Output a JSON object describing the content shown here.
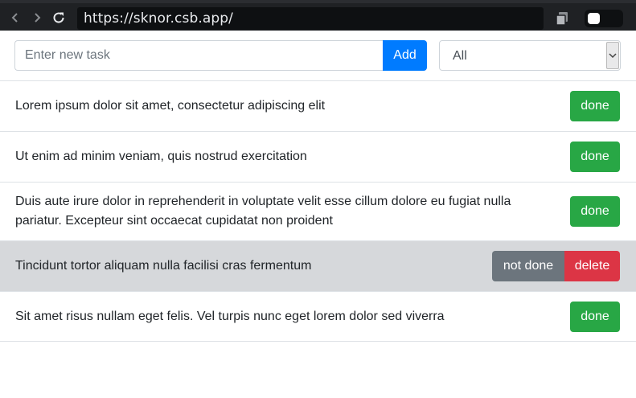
{
  "browser": {
    "url": "https://sknor.csb.app/"
  },
  "form": {
    "input_placeholder": "Enter new task",
    "input_value": "",
    "add_label": "Add",
    "filter_selected": "All"
  },
  "tasks": [
    {
      "text": "Lorem ipsum dolor sit amet, consectetur adipiscing elit",
      "completed": false,
      "done_label": "done"
    },
    {
      "text": "Ut enim ad minim veniam, quis nostrud exercitation",
      "completed": false,
      "done_label": "done"
    },
    {
      "text": "Duis aute irure dolor in reprehenderit in voluptate velit esse cillum dolore eu fugiat nulla pariatur. Excepteur sint occaecat cupidatat non proident",
      "completed": false,
      "done_label": "done"
    },
    {
      "text": "Tincidunt tortor aliquam nulla facilisi cras fermentum",
      "completed": true,
      "not_done_label": "not done",
      "delete_label": "delete"
    },
    {
      "text": "Sit amet risus nullam eget felis. Vel turpis nunc eget lorem dolor sed viverra",
      "completed": false,
      "done_label": "done"
    }
  ],
  "colors": {
    "primary": "#007bff",
    "success": "#28a745",
    "secondary": "#6c757d",
    "danger": "#dc3545",
    "completed_row": "#d6d8db"
  },
  "icons": {
    "back": "arrow-left-icon",
    "forward": "arrow-right-icon",
    "reload": "reload-icon",
    "copy": "copy-icon",
    "select_arrow": "chevron-down-icon"
  }
}
